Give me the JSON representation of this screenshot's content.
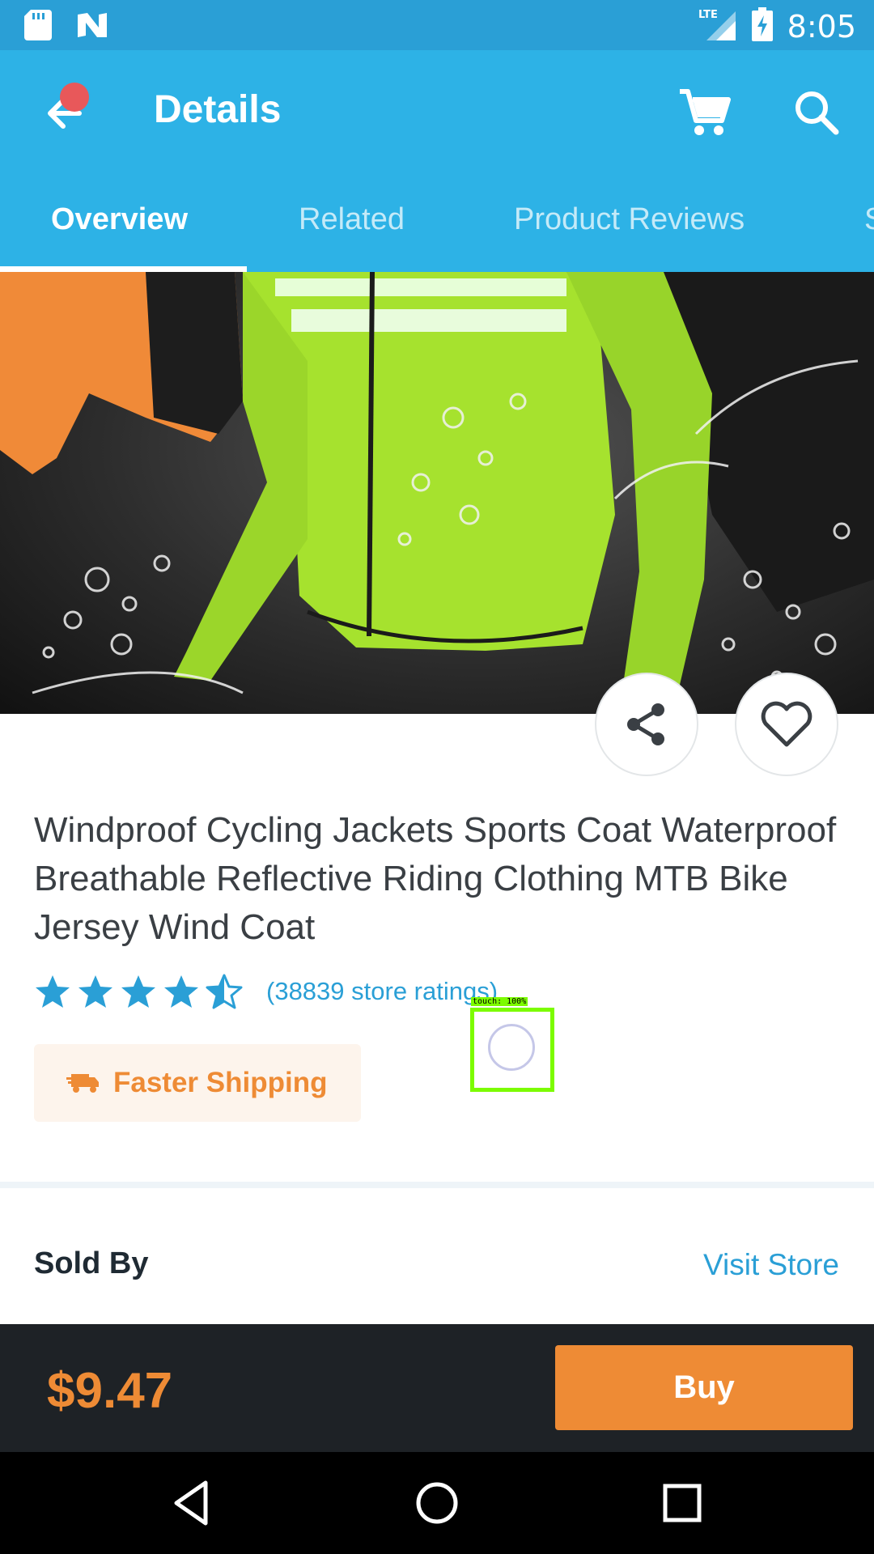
{
  "status_bar": {
    "time": "8:05",
    "network": "LTE"
  },
  "app_bar": {
    "title": "Details"
  },
  "tabs": [
    {
      "label": "Overview",
      "active": true
    },
    {
      "label": "Related",
      "active": false
    },
    {
      "label": "Product Reviews",
      "active": false
    },
    {
      "label": "S",
      "active": false
    }
  ],
  "product": {
    "title": "Windproof Cycling Jackets Sports Coat Waterproof Breathable Reflective Riding Clothing MTB Bike Jersey Wind Coat",
    "rating_stars": 4.5,
    "rating_count_text": "(38839 store ratings)",
    "shipping_label": "Faster Shipping"
  },
  "touch_indicator": {
    "label": "touch: 100%"
  },
  "seller": {
    "sold_by_label": "Sold By",
    "visit_store_label": "Visit Store"
  },
  "buy_bar": {
    "price": "$9.47",
    "buy_label": "Buy"
  },
  "colors": {
    "primary_blue": "#2db2e6",
    "accent_orange": "#ee8b35",
    "jacket_green": "#a6e22e"
  },
  "icons": [
    "sd-card-icon",
    "n-notification-icon",
    "signal-icon",
    "battery-icon",
    "back-arrow-icon",
    "cart-icon",
    "search-icon",
    "share-icon",
    "heart-icon",
    "star-icon",
    "truck-icon",
    "nav-back-icon",
    "nav-home-icon",
    "nav-recents-icon"
  ]
}
